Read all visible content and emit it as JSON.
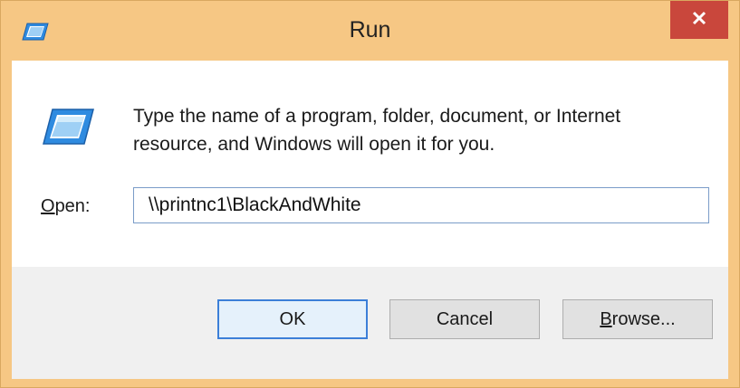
{
  "window": {
    "title": "Run",
    "title_icon": "run-icon",
    "close_icon": "close-icon"
  },
  "content": {
    "description_line1": "Type the name of a program, folder, document, or Internet",
    "description_line2": "resource, and Windows will open it for you.",
    "icon": "run-icon"
  },
  "open": {
    "label_accel": "O",
    "label_rest": "pen:",
    "value": "\\\\printnc1\\BlackAndWhite"
  },
  "buttons": {
    "ok": "OK",
    "cancel": "Cancel",
    "browse_accel": "B",
    "browse_rest": "rowse..."
  },
  "colors": {
    "frame": "#f6c784",
    "close": "#c9473c",
    "default_button_border": "#3c7fd8"
  }
}
